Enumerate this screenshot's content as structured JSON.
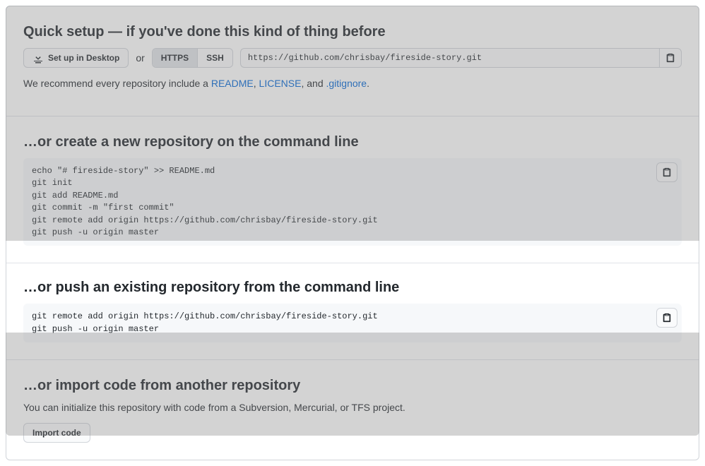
{
  "quick": {
    "heading": "Quick setup — if you've done this kind of thing before",
    "desktop_button": "Set up in Desktop",
    "or_text": "or",
    "https_label": "HTTPS",
    "ssh_label": "SSH",
    "clone_url": "https://github.com/chrisbay/fireside-story.git",
    "recommend_prefix": "We recommend every repository include a ",
    "readme_link": "README",
    "comma1": ", ",
    "license_link": "LICENSE",
    "comma2": ", and ",
    "gitignore_link": ".gitignore",
    "period": "."
  },
  "create": {
    "heading": "…or create a new repository on the command line",
    "code": "echo \"# fireside-story\" >> README.md\ngit init\ngit add README.md\ngit commit -m \"first commit\"\ngit remote add origin https://github.com/chrisbay/fireside-story.git\ngit push -u origin master"
  },
  "push": {
    "heading": "…or push an existing repository from the command line",
    "code": "git remote add origin https://github.com/chrisbay/fireside-story.git\ngit push -u origin master"
  },
  "import": {
    "heading": "…or import code from another repository",
    "body": "You can initialize this repository with code from a Subversion, Mercurial, or TFS project.",
    "button": "Import code"
  }
}
